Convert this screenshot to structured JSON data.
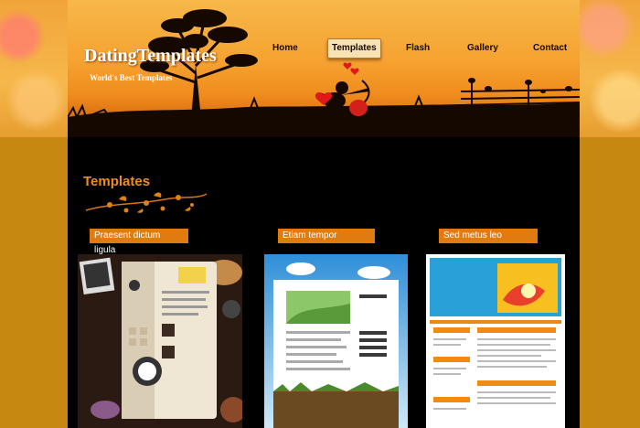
{
  "site": {
    "logo": "DatingTemplates",
    "tagline": "World's Best Templates"
  },
  "nav": {
    "items": [
      {
        "label": "Home"
      },
      {
        "label": "Templates",
        "active": true
      },
      {
        "label": "Flash"
      },
      {
        "label": "Gallery"
      },
      {
        "label": "Contact"
      }
    ]
  },
  "main": {
    "section_title": "Templates",
    "templates": [
      {
        "title": "Praesent dictum ligula"
      },
      {
        "title": "Etiam tempor"
      },
      {
        "title": "Sed metus leo"
      }
    ]
  },
  "colors": {
    "accent": "#e07b10",
    "title": "#ee8f1c",
    "page_bg": "#000000",
    "outer_bg": "#c78812"
  }
}
